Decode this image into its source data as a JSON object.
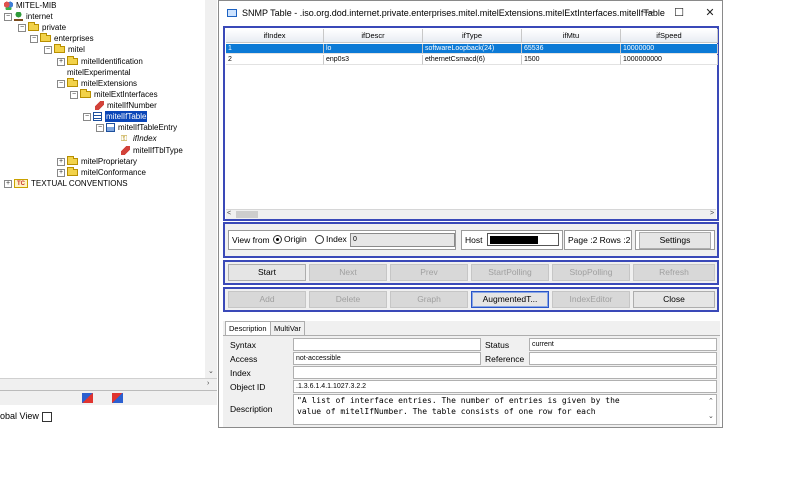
{
  "tree": {
    "nodes": {
      "mitel_mib": "MITEL-MIB",
      "internet": "internet",
      "private": "private",
      "enterprises": "enterprises",
      "mitel": "mitel",
      "mitelIdentification": "mitelIdentification",
      "mitelExperimental": "mitelExperimental",
      "mitelExtensions": "mitelExtensions",
      "mitelExtInterfaces": "mitelExtInterfaces",
      "mitelIfNumber": "mitelIfNumber",
      "mitelIfTable": "mitelIfTable",
      "mitelIfTableEntry": "mitelIfTableEntry",
      "ifIndex": "ifIndex",
      "mitelIfTblType": "mitelIfTblType",
      "mitelProprietary": "mitelProprietary",
      "mitelConformance": "mitelConformance",
      "textual_conventions": "TEXTUAL CONVENTIONS",
      "tc_badge": "TC"
    },
    "global_view_label": "obal View"
  },
  "window": {
    "title": "SNMP Table - .iso.org.dod.internet.private.enterprises.mitel.mitelExtensions.mitelExtInterfaces.mitelIfTable",
    "min": "—",
    "max": "☐",
    "close": "✕"
  },
  "table": {
    "columns": [
      "ifIndex",
      "ifDescr",
      "ifType",
      "ifMtu",
      "ifSpeed"
    ],
    "rows": [
      [
        "1",
        "lo",
        "softwareLoopback(24)",
        "65536",
        "10000000"
      ],
      [
        "2",
        "enp0s3",
        "ethernetCsmacd(6)",
        "1500",
        "1000000000"
      ]
    ],
    "selected_row": 1,
    "scroll_left": "<",
    "scroll_right": ">"
  },
  "view_from": {
    "label": "View from",
    "origin": "Origin",
    "index": "Index",
    "index_value": "0",
    "host_label": "Host",
    "page_info": "Page :2 Rows :2",
    "settings": "Settings"
  },
  "buttons_row1": [
    "Start",
    "Next",
    "Prev",
    "StartPolling",
    "StopPolling",
    "Refresh"
  ],
  "buttons_row2": [
    "Add",
    "Delete",
    "Graph",
    "AugmentedT...",
    "IndexEditor",
    "Close"
  ],
  "description": {
    "tabs": [
      "Description",
      "MultiVar"
    ],
    "syntax_label": "Syntax",
    "syntax_value": "",
    "status_label": "Status",
    "status_value": "current",
    "access_label": "Access",
    "access_value": "not-accessible",
    "reference_label": "Reference",
    "reference_value": "",
    "index_label": "Index",
    "index_value": "",
    "objectid_label": "Object ID",
    "objectid_value": ".1.3.6.1.4.1.1027.3.2.2",
    "description_label": "Description",
    "description_line1": "\"A list of interface entries. The number of entries is given by the",
    "description_line2": "value of mitelIfNumber. The table consists of one row for each"
  },
  "colors": {
    "selection": "#0a46b8",
    "row_selection": "#0c7ad6",
    "panel_border": "#3a49b8"
  }
}
